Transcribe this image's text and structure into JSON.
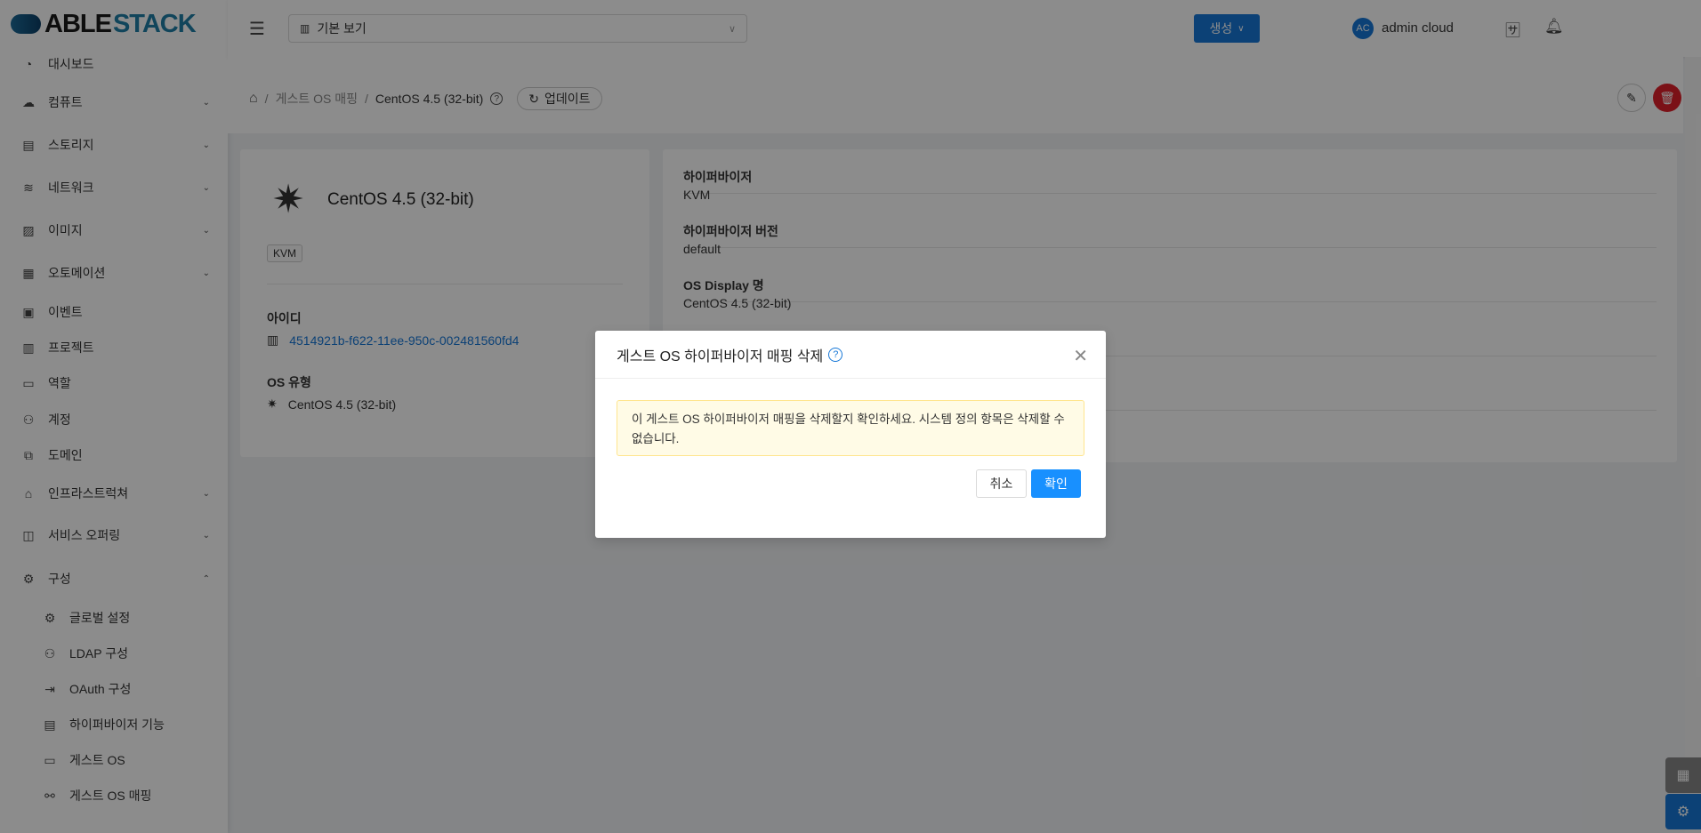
{
  "logo": {
    "part1": "ABLE",
    "part2": "STACK"
  },
  "header": {
    "view_select": "기본 보기",
    "create_label": "생성",
    "user_initials": "AC",
    "user_name": "admin cloud"
  },
  "sidebar": {
    "items": [
      {
        "label": "대시보드",
        "icon": "dashboard-icon",
        "glyph": "◔"
      },
      {
        "label": "컴퓨트",
        "icon": "cloud-icon",
        "glyph": "☁",
        "chev": "⌄"
      },
      {
        "label": "스토리지",
        "icon": "storage-icon",
        "glyph": "▤",
        "chev": "⌄"
      },
      {
        "label": "네트워크",
        "icon": "wifi-icon",
        "glyph": "≋",
        "chev": "⌄"
      },
      {
        "label": "이미지",
        "icon": "picture-icon",
        "glyph": "▨",
        "chev": "⌄"
      },
      {
        "label": "오토메이션",
        "icon": "appstore-icon",
        "glyph": "▦",
        "chev": "⌄"
      },
      {
        "label": "이벤트",
        "icon": "schedule-icon",
        "glyph": "▣"
      },
      {
        "label": "프로젝트",
        "icon": "project-icon",
        "glyph": "▥"
      },
      {
        "label": "역할",
        "icon": "idcard-icon",
        "glyph": "▭"
      },
      {
        "label": "계정",
        "icon": "user-icon",
        "glyph": "⚇"
      },
      {
        "label": "도메인",
        "icon": "block-icon",
        "glyph": "⧉"
      },
      {
        "label": "인프라스트럭쳐",
        "icon": "bank-icon",
        "glyph": "⌂",
        "chev": "⌄"
      },
      {
        "label": "서비스 오퍼링",
        "icon": "shopping-icon",
        "glyph": "◫",
        "chev": "⌄"
      },
      {
        "label": "구성",
        "icon": "setting-icon",
        "glyph": "⚙",
        "chev": "⌃"
      }
    ],
    "sub_items": [
      {
        "label": "글로벌 설정",
        "icon": "setting-icon",
        "glyph": "⚙"
      },
      {
        "label": "LDAP 구성",
        "icon": "team-icon",
        "glyph": "⚇"
      },
      {
        "label": "OAuth 구성",
        "icon": "login-icon",
        "glyph": "⇥"
      },
      {
        "label": "하이퍼바이저 기능",
        "icon": "database-icon",
        "glyph": "▤"
      },
      {
        "label": "게스트 OS",
        "icon": "laptop-icon",
        "glyph": "▭"
      },
      {
        "label": "게스트 OS 매핑",
        "icon": "api-icon",
        "glyph": "⚯"
      }
    ]
  },
  "breadcrumb": {
    "parent": "게스트 OS 매핑",
    "current": "CentOS 4.5 (32-bit)",
    "refresh": "업데이트"
  },
  "detail": {
    "name": "CentOS 4.5 (32-bit)",
    "tag": "KVM",
    "id_label": "아이디",
    "id_value": "4514921b-f622-11ee-950c-002481560fd4",
    "ostype_label": "OS 유형",
    "ostype_value": "CentOS 4.5 (32-bit)"
  },
  "info": [
    {
      "label": "하이퍼바이저",
      "value": "KVM"
    },
    {
      "label": "하이퍼바이저 버전",
      "value": "default"
    },
    {
      "label": "OS Display 명",
      "value": "CentOS 4.5 (32-bit)"
    }
  ],
  "modal": {
    "title": "게스트 OS 하이퍼바이저 매핑 삭제",
    "message": "이 게스트 OS 하이퍼바이저 매핑을 삭제할지 확인하세요. 시스템 정의 항목은 삭제할 수 없습니다.",
    "cancel": "취소",
    "ok": "확인"
  },
  "colors": {
    "primary": "#1677d7",
    "danger": "#e0202a",
    "alert_bg": "#fffbe6"
  }
}
